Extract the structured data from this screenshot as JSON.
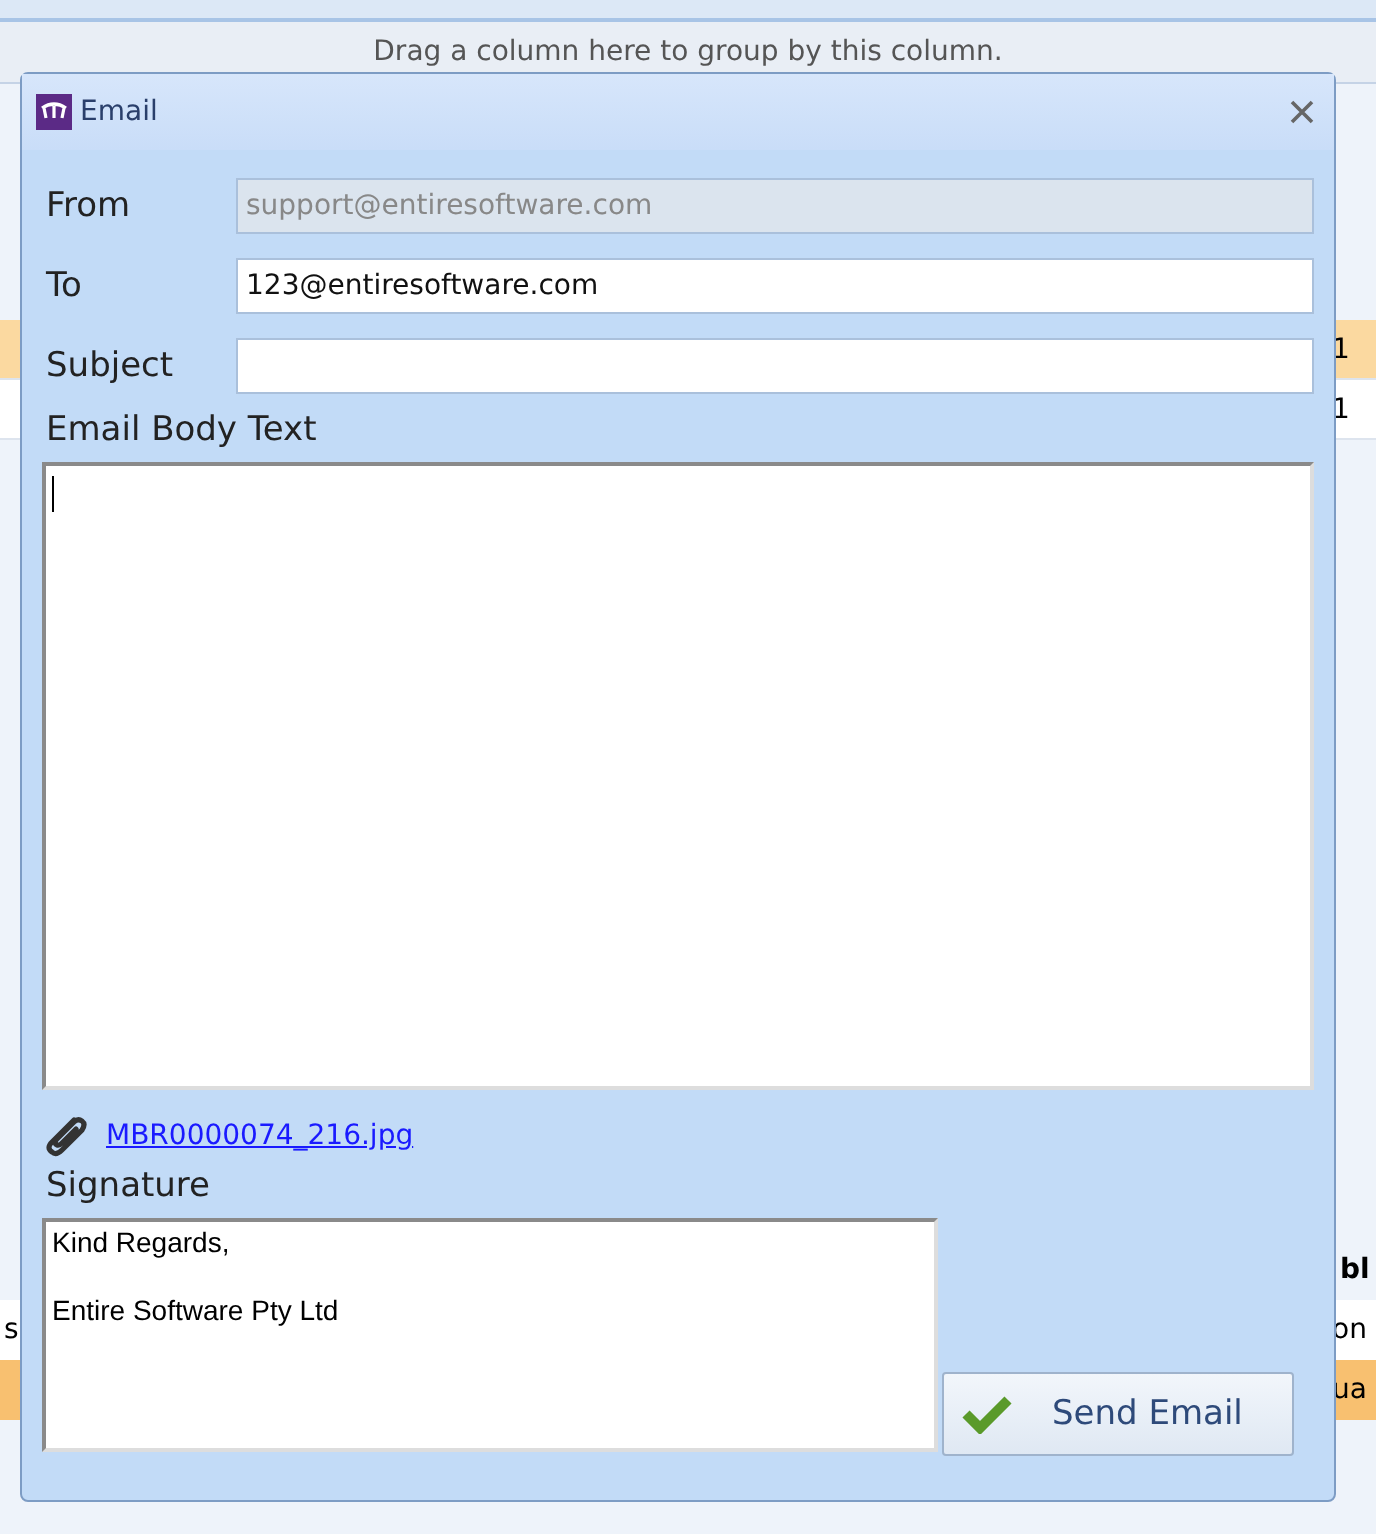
{
  "background": {
    "group_hint": "Drag a column here to group by this column.",
    "upper_rows": [
      {
        "cell": "1",
        "selected": true
      },
      {
        "cell": "1",
        "selected": false
      }
    ],
    "lower_header": "bl",
    "lower_rows": [
      {
        "left": "s",
        "right": "on",
        "selected": false
      },
      {
        "left": "",
        "right": "ua",
        "selected": true
      }
    ]
  },
  "dialog": {
    "title": "Email",
    "fields": [
      {
        "label": "From",
        "value": "support@entiresoftware.com",
        "disabled": true
      },
      {
        "label": "To",
        "value": "123@entiresoftware.com",
        "disabled": false
      },
      {
        "label": "Subject",
        "disabled": false
      }
    ],
    "body_label": "Email Body Text",
    "attachment": "MBR0000074_216.jpg",
    "signature_label": "Signature",
    "signature_lines": [
      "Kind Regards,",
      "Entire Software Pty Ltd"
    ],
    "send_button": "Send Email"
  }
}
